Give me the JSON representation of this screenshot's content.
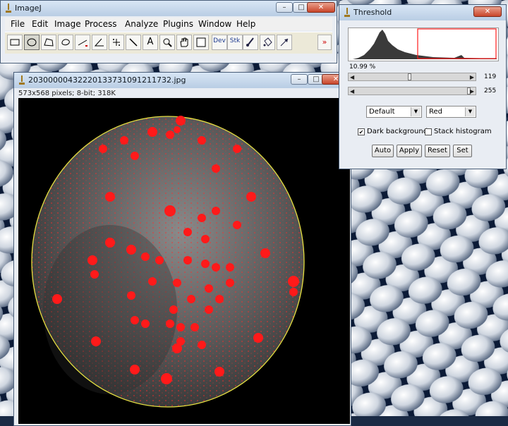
{
  "main_window": {
    "title": "ImageJ",
    "menus": [
      "File",
      "Edit",
      "Image",
      "Process",
      "Analyze",
      "Plugins",
      "Window",
      "Help"
    ],
    "tools": [
      {
        "id": "rectangle",
        "icon": "rectangle-select-icon"
      },
      {
        "id": "oval",
        "icon": "oval-select-icon"
      },
      {
        "id": "polygon",
        "icon": "polygon-select-icon"
      },
      {
        "id": "freehand",
        "icon": "freehand-select-icon"
      },
      {
        "id": "line",
        "icon": "line-icon"
      },
      {
        "id": "angle",
        "icon": "angle-icon"
      },
      {
        "id": "point",
        "icon": "multi-point-icon"
      },
      {
        "id": "wand",
        "icon": "wand-icon"
      },
      {
        "id": "text",
        "icon": "text-icon",
        "label": "A"
      },
      {
        "id": "magnifier",
        "icon": "magnifier-icon"
      },
      {
        "id": "hand",
        "icon": "hand-icon"
      },
      {
        "id": "color",
        "icon": "color-picker-icon"
      },
      {
        "id": "dev",
        "icon": "dev-menu-icon",
        "label": "Dev"
      },
      {
        "id": "stk",
        "icon": "stack-menu-icon",
        "label": "Stk"
      },
      {
        "id": "brush",
        "icon": "brush-icon"
      },
      {
        "id": "flood",
        "icon": "flood-fill-icon"
      },
      {
        "id": "arrow",
        "icon": "arrow-icon"
      },
      {
        "id": "more",
        "icon": "more-tools-icon",
        "label": "»"
      }
    ]
  },
  "image_window": {
    "title": "20300000432220133731091211732.jpg",
    "info": "573x568 pixels; 8-bit; 318K"
  },
  "threshold": {
    "title": "Threshold",
    "percent": "10.99 %",
    "min_value": "119",
    "max_value": "255",
    "method": "Default",
    "mode": "Red",
    "dark_background_label": "Dark background",
    "dark_background_checked": true,
    "stack_histogram_label": "Stack histogram",
    "stack_histogram_checked": false,
    "buttons": {
      "auto": "Auto",
      "apply": "Apply",
      "reset": "Reset",
      "set": "Set"
    }
  },
  "colors": {
    "threshold_red": "#ff1a1a",
    "selection_yellow": "#e6e040",
    "titlebar": "#c8d9ee"
  },
  "window_controls": {
    "minimize": "–",
    "maximize": "□",
    "close": "✕"
  }
}
